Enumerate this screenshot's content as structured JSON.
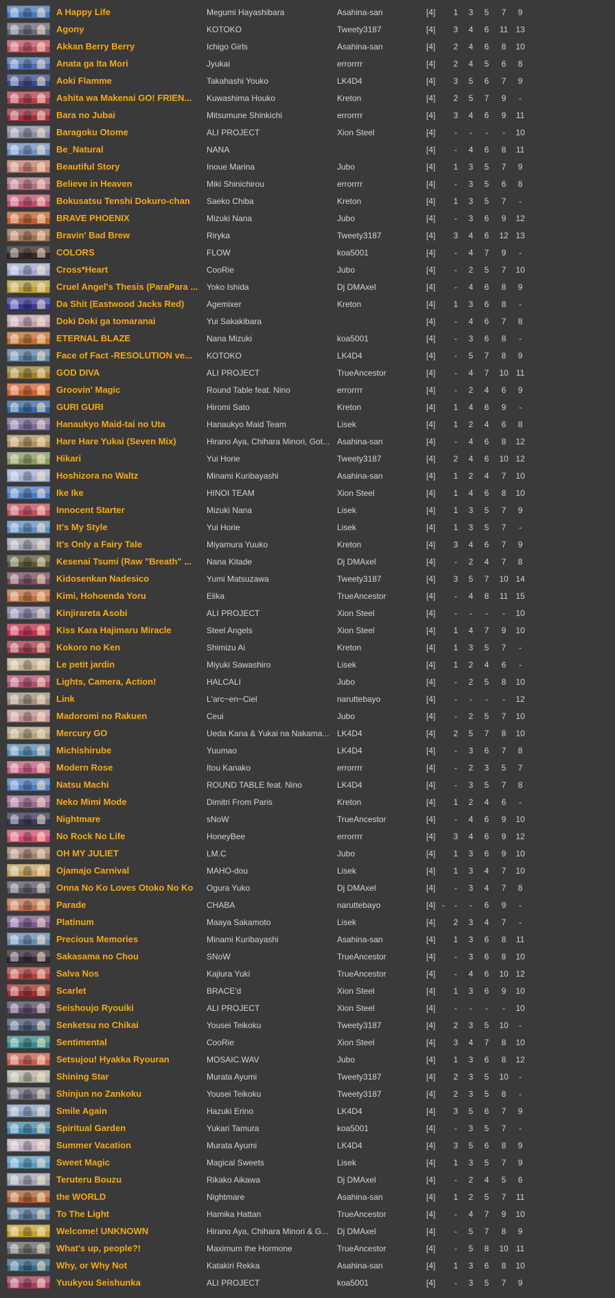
{
  "colors": {
    "background": "#3a3a3a",
    "title": "#f5a818",
    "text": "#d4d4d4"
  },
  "songs": [
    {
      "title": "A Happy Life",
      "artist": "Megumi Hayashibara",
      "mapper": "Asahina-san",
      "keys": "[4]",
      "levels": [
        "1",
        "3",
        "5",
        "7",
        "9"
      ],
      "thumb": "#4a7ab8"
    },
    {
      "title": "Agony",
      "artist": "KOTOKO",
      "mapper": "Tweety3187",
      "keys": "[4]",
      "levels": [
        "3",
        "4",
        "6",
        "11",
        "13"
      ],
      "thumb": "#6a6a7a"
    },
    {
      "title": "Akkan Berry Berry",
      "artist": "Ichigo Girls",
      "mapper": "Asahina-san",
      "keys": "[4]",
      "levels": [
        "2",
        "4",
        "6",
        "8",
        "10"
      ],
      "thumb": "#c05060"
    },
    {
      "title": "Anata ga Ita Mori",
      "artist": "Jyukai",
      "mapper": "errorrrr",
      "keys": "[4]",
      "levels": [
        "2",
        "4",
        "5",
        "6",
        "8"
      ],
      "thumb": "#5070b0"
    },
    {
      "title": "Aoki Flamme",
      "artist": "Takahashi Youko",
      "mapper": "LK4D4",
      "keys": "[4]",
      "levels": [
        "3",
        "5",
        "6",
        "7",
        "9"
      ],
      "thumb": "#3a4a8a"
    },
    {
      "title": "Ashita wa Makenai GO! FRIEN...",
      "artist": "Kuwashima Houko",
      "mapper": "Kreton",
      "keys": "[4]",
      "levels": [
        "2",
        "5",
        "7",
        "9",
        "-"
      ],
      "thumb": "#b04050"
    },
    {
      "title": "Bara no Jubai",
      "artist": "Mitsumune Shinkichi",
      "mapper": "errorrrr",
      "keys": "[4]",
      "levels": [
        "3",
        "4",
        "6",
        "9",
        "11"
      ],
      "thumb": "#a03040"
    },
    {
      "title": "Baragoku Otome",
      "artist": "ALI PROJECT",
      "mapper": "Xion Steel",
      "keys": "[4]",
      "levels": [
        "-",
        "-",
        "-",
        "-",
        "10"
      ],
      "thumb": "#8a8aa0"
    },
    {
      "title": "Be_Natural",
      "artist": "NANA",
      "mapper": "",
      "keys": "[4]",
      "levels": [
        "-",
        "4",
        "6",
        "8",
        "11"
      ],
      "thumb": "#7090c0"
    },
    {
      "title": "Beautiful Story",
      "artist": "Inoue Marina",
      "mapper": "Jubo",
      "keys": "[4]",
      "levels": [
        "1",
        "3",
        "5",
        "7",
        "9"
      ],
      "thumb": "#c08070"
    },
    {
      "title": "Believe in Heaven",
      "artist": "Miki Shinichirou",
      "mapper": "errorrrr",
      "keys": "[4]",
      "levels": [
        "-",
        "3",
        "5",
        "6",
        "8"
      ],
      "thumb": "#b07080"
    },
    {
      "title": "Bokusatsu Tenshi Dokuro-chan",
      "artist": "Saeko Chiba",
      "mapper": "Kreton",
      "keys": "[4]",
      "levels": [
        "1",
        "3",
        "5",
        "7",
        "-"
      ],
      "thumb": "#c05070"
    },
    {
      "title": "BRAVE PHOENIX",
      "artist": "Mizuki Nana",
      "mapper": "Jubo",
      "keys": "[4]",
      "levels": [
        "-",
        "3",
        "6",
        "9",
        "12"
      ],
      "thumb": "#c06030"
    },
    {
      "title": "Bravin' Bad Brew",
      "artist": "Riryka",
      "mapper": "Tweety3187",
      "keys": "[4]",
      "levels": [
        "3",
        "4",
        "6",
        "12",
        "13"
      ],
      "thumb": "#a07050"
    },
    {
      "title": "COLORS",
      "artist": "FLOW",
      "mapper": "koa5001",
      "keys": "[4]",
      "levels": [
        "-",
        "4",
        "7",
        "9",
        "-"
      ],
      "thumb": "#3a2a2a"
    },
    {
      "title": "Cross*Heart",
      "artist": "CooRie",
      "mapper": "Jubo",
      "keys": "[4]",
      "levels": [
        "-",
        "2",
        "5",
        "7",
        "10"
      ],
      "thumb": "#a0a8d0"
    },
    {
      "title": "Cruel Angel's Thesis (ParaPara ...",
      "artist": "Yoko Ishida",
      "mapper": "Dj DMAxel",
      "keys": "[4]",
      "levels": [
        "-",
        "4",
        "6",
        "8",
        "9"
      ],
      "thumb": "#b8a040"
    },
    {
      "title": "Da Shit (Eastwood Jacks Red)",
      "artist": "Agemixer",
      "mapper": "Kreton",
      "keys": "[4]",
      "levels": [
        "1",
        "3",
        "6",
        "8",
        "-"
      ],
      "thumb": "#3a3a9a"
    },
    {
      "title": "Doki Doki ga tomaranai",
      "artist": "Yui Sakakibara",
      "mapper": "",
      "keys": "[4]",
      "levels": [
        "-",
        "4",
        "6",
        "7",
        "8"
      ],
      "thumb": "#c0a0b0"
    },
    {
      "title": "ETERNAL BLAZE",
      "artist": "Nana Mizuki",
      "mapper": "koa5001",
      "keys": "[4]",
      "levels": [
        "-",
        "3",
        "6",
        "8",
        "-"
      ],
      "thumb": "#c07030"
    },
    {
      "title": "Face of Fact -RESOLUTION ve...",
      "artist": "KOTOKO",
      "mapper": "LK4D4",
      "keys": "[4]",
      "levels": [
        "-",
        "5",
        "7",
        "8",
        "9"
      ],
      "thumb": "#6080a0"
    },
    {
      "title": "GOD DIVA",
      "artist": "ALI PROJECT",
      "mapper": "TrueAncestor",
      "keys": "[4]",
      "levels": [
        "-",
        "4",
        "7",
        "10",
        "11"
      ],
      "thumb": "#9a8030"
    },
    {
      "title": "Groovin' Magic",
      "artist": "Round Table feat. Nino",
      "mapper": "errorrrr",
      "keys": "[4]",
      "levels": [
        "-",
        "2",
        "4",
        "6",
        "9"
      ],
      "thumb": "#d06030"
    },
    {
      "title": "GURI GURI",
      "artist": "Hiromi Sato",
      "mapper": "Kreton",
      "keys": "[4]",
      "levels": [
        "1",
        "4",
        "6",
        "9",
        "-"
      ],
      "thumb": "#3a6aa0"
    },
    {
      "title": "Hanaukyo Maid-tai no Uta",
      "artist": "Hanaukyo Maid Team",
      "mapper": "Lisek",
      "keys": "[4]",
      "levels": [
        "1",
        "2",
        "4",
        "6",
        "8"
      ],
      "thumb": "#7a6a9a"
    },
    {
      "title": "Hare Hare Yukai (Seven Mix)",
      "artist": "Hirano Aya, Chihara Minori, Got...",
      "mapper": "Asahina-san",
      "keys": "[4]",
      "levels": [
        "-",
        "4",
        "6",
        "8",
        "12"
      ],
      "thumb": "#b09060"
    },
    {
      "title": "Hikari",
      "artist": "Yui Horie",
      "mapper": "Tweety3187",
      "keys": "[4]",
      "levels": [
        "2",
        "4",
        "6",
        "10",
        "12"
      ],
      "thumb": "#8a9a60"
    },
    {
      "title": "Hoshizora no Waltz",
      "artist": "Minami Kuribayashi",
      "mapper": "Asahina-san",
      "keys": "[4]",
      "levels": [
        "1",
        "2",
        "4",
        "7",
        "10"
      ],
      "thumb": "#a0b0d0"
    },
    {
      "title": "Ike Ike",
      "artist": "HINOI TEAM",
      "mapper": "Xion Steel",
      "keys": "[4]",
      "levels": [
        "1",
        "4",
        "6",
        "8",
        "10"
      ],
      "thumb": "#4a7ac0"
    },
    {
      "title": "Innocent Starter",
      "artist": "Mizuki Nana",
      "mapper": "Lisek",
      "keys": "[4]",
      "levels": [
        "1",
        "3",
        "5",
        "7",
        "9"
      ],
      "thumb": "#c05060"
    },
    {
      "title": "It's My Style",
      "artist": "Yui Horie",
      "mapper": "Lisek",
      "keys": "[4]",
      "levels": [
        "1",
        "3",
        "5",
        "7",
        "-"
      ],
      "thumb": "#6090c0"
    },
    {
      "title": "It's Only a Fairy Tale",
      "artist": "Miyamura Yuuko",
      "mapper": "Kreton",
      "keys": "[4]",
      "levels": [
        "3",
        "4",
        "6",
        "7",
        "9"
      ],
      "thumb": "#a0a0b0"
    },
    {
      "title": "Kesenai Tsumi (Raw \"Breath\" ...",
      "artist": "Nana Kitade",
      "mapper": "Dj DMAxel",
      "keys": "[4]",
      "levels": [
        "-",
        "2",
        "4",
        "7",
        "8"
      ],
      "thumb": "#5a5a3a"
    },
    {
      "title": "Kidosenkan Nadesico",
      "artist": "Yumi Matsuzawa",
      "mapper": "Tweety3187",
      "keys": "[4]",
      "levels": [
        "3",
        "5",
        "7",
        "10",
        "14"
      ],
      "thumb": "#7a5060"
    },
    {
      "title": "Kimi, Hohoenda Yoru",
      "artist": "Elika",
      "mapper": "TrueAncestor",
      "keys": "[4]",
      "levels": [
        "-",
        "4",
        "8",
        "11",
        "15"
      ],
      "thumb": "#c07040"
    },
    {
      "title": "Kinjirareta Asobi",
      "artist": "ALI PROJECT",
      "mapper": "Xion Steel",
      "keys": "[4]",
      "levels": [
        "-",
        "-",
        "-",
        "-",
        "10"
      ],
      "thumb": "#8080a0"
    },
    {
      "title": "Kiss Kara Hajimaru Miracle",
      "artist": "Steel Angels",
      "mapper": "Xion Steel",
      "keys": "[4]",
      "levels": [
        "1",
        "4",
        "7",
        "9",
        "10"
      ],
      "thumb": "#c03050"
    },
    {
      "title": "Kokoro no Ken",
      "artist": "Shimizu Ai",
      "mapper": "Kreton",
      "keys": "[4]",
      "levels": [
        "1",
        "3",
        "5",
        "7",
        "-"
      ],
      "thumb": "#a04050"
    },
    {
      "title": "Le petit jardin",
      "artist": "Miyuki Sawashiro",
      "mapper": "Lisek",
      "keys": "[4]",
      "levels": [
        "1",
        "2",
        "4",
        "6",
        "-"
      ],
      "thumb": "#c0b090"
    },
    {
      "title": "Lights, Camera, Action!",
      "artist": "HALCALI",
      "mapper": "Jubo",
      "keys": "[4]",
      "levels": [
        "-",
        "2",
        "5",
        "8",
        "10"
      ],
      "thumb": "#b05070"
    },
    {
      "title": "Link",
      "artist": "L'arc~en~Ciel",
      "mapper": "naruttebayo",
      "keys": "[4]",
      "levels": [
        "-",
        "-",
        "-",
        "-",
        "12"
      ],
      "thumb": "#a09080"
    },
    {
      "title": "Madoromi no Rakuen",
      "artist": "Ceui",
      "mapper": "Jubo",
      "keys": "[4]",
      "levels": [
        "-",
        "2",
        "5",
        "7",
        "10"
      ],
      "thumb": "#c09090"
    },
    {
      "title": "Mercury GO",
      "artist": "Ueda Kana & Yukai na Nakama...",
      "mapper": "LK4D4",
      "keys": "[4]",
      "levels": [
        "2",
        "5",
        "7",
        "8",
        "10"
      ],
      "thumb": "#b0a080"
    },
    {
      "title": "Michishirube",
      "artist": "Yuumao",
      "mapper": "LK4D4",
      "keys": "[4]",
      "levels": [
        "-",
        "3",
        "6",
        "7",
        "8"
      ],
      "thumb": "#5a8ab0"
    },
    {
      "title": "Modern Rose",
      "artist": "Itou Kanako",
      "mapper": "errorrrr",
      "keys": "[4]",
      "levels": [
        "-",
        "2",
        "3",
        "5",
        "7"
      ],
      "thumb": "#c06080"
    },
    {
      "title": "Natsu Machi",
      "artist": "ROUND TABLE feat. Nino",
      "mapper": "LK4D4",
      "keys": "[4]",
      "levels": [
        "-",
        "3",
        "5",
        "7",
        "8"
      ],
      "thumb": "#5080c0"
    },
    {
      "title": "Neko Mimi Mode",
      "artist": "Dimitri From Paris",
      "mapper": "Kreton",
      "keys": "[4]",
      "levels": [
        "1",
        "2",
        "4",
        "6",
        "-"
      ],
      "thumb": "#9a6a90"
    },
    {
      "title": "Nightmare",
      "artist": "sNoW",
      "mapper": "TrueAncestor",
      "keys": "[4]",
      "levels": [
        "-",
        "4",
        "6",
        "9",
        "10"
      ],
      "thumb": "#3a3a5a"
    },
    {
      "title": "No Rock No Life",
      "artist": "HoneyBee",
      "mapper": "errorrrr",
      "keys": "[4]",
      "levels": [
        "3",
        "4",
        "6",
        "9",
        "12"
      ],
      "thumb": "#d05070"
    },
    {
      "title": "OH MY JULIET",
      "artist": "LM.C",
      "mapper": "Jubo",
      "keys": "[4]",
      "levels": [
        "1",
        "3",
        "6",
        "9",
        "10"
      ],
      "thumb": "#a08070"
    },
    {
      "title": "Ojamajo Carnival",
      "artist": "MAHO-dou",
      "mapper": "Lisek",
      "keys": "[4]",
      "levels": [
        "1",
        "3",
        "4",
        "7",
        "10"
      ],
      "thumb": "#c0a060"
    },
    {
      "title": "Onna No Ko Loves Otoko No Ko",
      "artist": "Ogura Yuko",
      "mapper": "Dj DMAxel",
      "keys": "[4]",
      "levels": [
        "-",
        "3",
        "4",
        "7",
        "8"
      ],
      "thumb": "#5a5a6a"
    },
    {
      "title": "Parade",
      "artist": "CHABA",
      "mapper": "naruttebayo",
      "keys": "[4]",
      "levels": [
        "-",
        "-",
        "-",
        "6",
        "9",
        "-"
      ],
      "thumb": "#c07050"
    },
    {
      "title": "Platinum",
      "artist": "Maaya Sakamoto",
      "mapper": "Lisek",
      "keys": "[4]",
      "levels": [
        "2",
        "3",
        "4",
        "7",
        "-"
      ],
      "thumb": "#7a5a8a"
    },
    {
      "title": "Precious Memories",
      "artist": "Minami Kuribayashi",
      "mapper": "Asahina-san",
      "keys": "[4]",
      "levels": [
        "1",
        "3",
        "6",
        "8",
        "11"
      ],
      "thumb": "#6a8ab0"
    },
    {
      "title": "Sakasama no Chou",
      "artist": "SNoW",
      "mapper": "TrueAncestor",
      "keys": "[4]",
      "levels": [
        "-",
        "3",
        "6",
        "8",
        "10"
      ],
      "thumb": "#3a2a3a"
    },
    {
      "title": "Salva Nos",
      "artist": "Kajiura Yuki",
      "mapper": "TrueAncestor",
      "keys": "[4]",
      "levels": [
        "-",
        "4",
        "6",
        "10",
        "12"
      ],
      "thumb": "#b04040"
    },
    {
      "title": "Scarlet",
      "artist": "BRACE'd",
      "mapper": "Xion Steel",
      "keys": "[4]",
      "levels": [
        "1",
        "3",
        "6",
        "9",
        "10"
      ],
      "thumb": "#a03030"
    },
    {
      "title": "Seishoujo Ryouiki",
      "artist": "ALI PROJECT",
      "mapper": "Xion Steel",
      "keys": "[4]",
      "levels": [
        "-",
        "-",
        "-",
        "-",
        "10"
      ],
      "thumb": "#5a4a6a"
    },
    {
      "title": "Senketsu no Chikai",
      "artist": "Yousei Teikoku",
      "mapper": "Tweety3187",
      "keys": "[4]",
      "levels": [
        "2",
        "3",
        "5",
        "10",
        "-"
      ],
      "thumb": "#4a5a7a"
    },
    {
      "title": "Sentimental",
      "artist": "CooRie",
      "mapper": "Xion Steel",
      "keys": "[4]",
      "levels": [
        "3",
        "4",
        "7",
        "8",
        "10"
      ],
      "thumb": "#3a8a8a"
    },
    {
      "title": "Setsujou! Hyakka Ryouran",
      "artist": "MOSAIC.WAV",
      "mapper": "Jubo",
      "keys": "[4]",
      "levels": [
        "1",
        "3",
        "6",
        "8",
        "12"
      ],
      "thumb": "#c06050"
    },
    {
      "title": "Shining Star",
      "artist": "Murata Ayumi",
      "mapper": "Tweety3187",
      "keys": "[4]",
      "levels": [
        "2",
        "3",
        "5",
        "10",
        "-"
      ],
      "thumb": "#b0b0a0"
    },
    {
      "title": "Shinjun no Zankoku",
      "artist": "Yousei Teikoku",
      "mapper": "Tweety3187",
      "keys": "[4]",
      "levels": [
        "2",
        "3",
        "5",
        "8",
        "-"
      ],
      "thumb": "#6a6a7a"
    },
    {
      "title": "Smile Again",
      "artist": "Hazuki Erino",
      "mapper": "LK4D4",
      "keys": "[4]",
      "levels": [
        "3",
        "5",
        "6",
        "7",
        "9"
      ],
      "thumb": "#8aa0c0"
    },
    {
      "title": "Spiritual Garden",
      "artist": "Yukari Tamura",
      "mapper": "koa5001",
      "keys": "[4]",
      "levels": [
        "-",
        "3",
        "5",
        "7",
        "-"
      ],
      "thumb": "#4a8ab0"
    },
    {
      "title": "Summer Vacation",
      "artist": "Murata Ayumi",
      "mapper": "LK4D4",
      "keys": "[4]",
      "levels": [
        "3",
        "5",
        "6",
        "8",
        "9"
      ],
      "thumb": "#c0b0c0"
    },
    {
      "title": "Sweet Magic",
      "artist": "Magical Sweets",
      "mapper": "Lisek",
      "keys": "[4]",
      "levels": [
        "1",
        "3",
        "5",
        "7",
        "9"
      ],
      "thumb": "#5a9ac0"
    },
    {
      "title": "Teruteru Bouzu",
      "artist": "Rikako Aikawa",
      "mapper": "Dj DMAxel",
      "keys": "[4]",
      "levels": [
        "-",
        "2",
        "4",
        "5",
        "6"
      ],
      "thumb": "#a0a0b0"
    },
    {
      "title": "the WORLD",
      "artist": "Nightmare",
      "mapper": "Asahina-san",
      "keys": "[4]",
      "levels": [
        "1",
        "2",
        "5",
        "7",
        "11"
      ],
      "thumb": "#b06030"
    },
    {
      "title": "To The Light",
      "artist": "Hamika Hattan",
      "mapper": "TrueAncestor",
      "keys": "[4]",
      "levels": [
        "-",
        "4",
        "7",
        "9",
        "10"
      ],
      "thumb": "#5a7a9a"
    },
    {
      "title": "Welcome! UNKNOWN",
      "artist": "Hirano Aya, Chihara Minori & G...",
      "mapper": "Dj DMAxel",
      "keys": "[4]",
      "levels": [
        "-",
        "5",
        "7",
        "8",
        "9"
      ],
      "thumb": "#c0a030"
    },
    {
      "title": "What's up, people?!",
      "artist": "Maximum the Hormone",
      "mapper": "TrueAncestor",
      "keys": "[4]",
      "levels": [
        "-",
        "5",
        "8",
        "10",
        "11"
      ],
      "thumb": "#6a6a6a"
    },
    {
      "title": "Why, or Why Not",
      "artist": "Katakiri Rekka",
      "mapper": "Asahina-san",
      "keys": "[4]",
      "levels": [
        "1",
        "3",
        "6",
        "8",
        "10"
      ],
      "thumb": "#3a6a8a"
    },
    {
      "title": "Yuukyou Seishunka",
      "artist": "ALI PROJECT",
      "mapper": "koa5001",
      "keys": "[4]",
      "levels": [
        "-",
        "3",
        "5",
        "7",
        "9"
      ],
      "thumb": "#a04060"
    }
  ]
}
